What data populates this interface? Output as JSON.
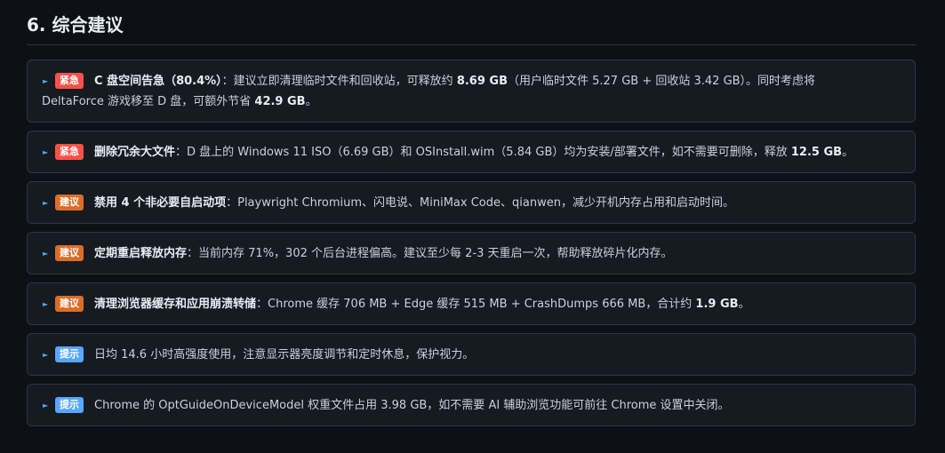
{
  "section": {
    "title": "6. 综合建议"
  },
  "items": [
    {
      "badge": "紧急",
      "lead": "C 盘空间告急（80.4%）",
      "parts": [
        "：建议立即清理临时文件和回收站，可释放约 ",
        "8.69 GB",
        "（用户临时文件 5.27 GB + 回收站 3.42 GB）。同时考虑将",
        "DeltaForce 游戏移至 D 盘，可额外节省 ",
        "42.9 GB",
        "。"
      ]
    },
    {
      "badge": "紧急",
      "lead": "删除冗余大文件",
      "parts": [
        "：D 盘上的 Windows 11 ISO（6.69 GB）和 OSInstall.wim（5.84 GB）均为安装/部署文件，如不需要可删除，释放 ",
        "12.5 GB",
        "。"
      ]
    },
    {
      "badge": "建议",
      "lead": "禁用 4 个非必要自启动项",
      "parts": [
        "：Playwright Chromium、闪电说、MiniMax Code、qianwen，减少开机内存占用和启动时间。"
      ]
    },
    {
      "badge": "建议",
      "lead": "定期重启释放内存",
      "parts": [
        "：当前内存 71%，302 个后台进程偏高。建议至少每 2-3 天重启一次，帮助释放碎片化内存。"
      ]
    },
    {
      "badge": "建议",
      "lead": "清理浏览器缓存和应用崩溃转储",
      "parts": [
        "：Chrome 缓存 706 MB + Edge 缓存 515 MB + CrashDumps 666 MB，合计约 ",
        "1.9 GB",
        "。"
      ]
    },
    {
      "badge": "提示",
      "parts": [
        "日均 14.6 小时高强度使用，注意显示器亮度调节和定时休息，保护视力。"
      ]
    },
    {
      "badge": "提示",
      "parts": [
        "Chrome 的 OptGuideOnDeviceModel 权重文件占用 3.98 GB，如不需要 AI 辅助浏览功能可前往 Chrome 设置中关闭。"
      ]
    }
  ],
  "colors": {
    "urgent": "#f85149",
    "advice": "#db6d28",
    "tip": "#58a6ff"
  },
  "icons": {
    "bullet": "triangle-right-icon"
  }
}
